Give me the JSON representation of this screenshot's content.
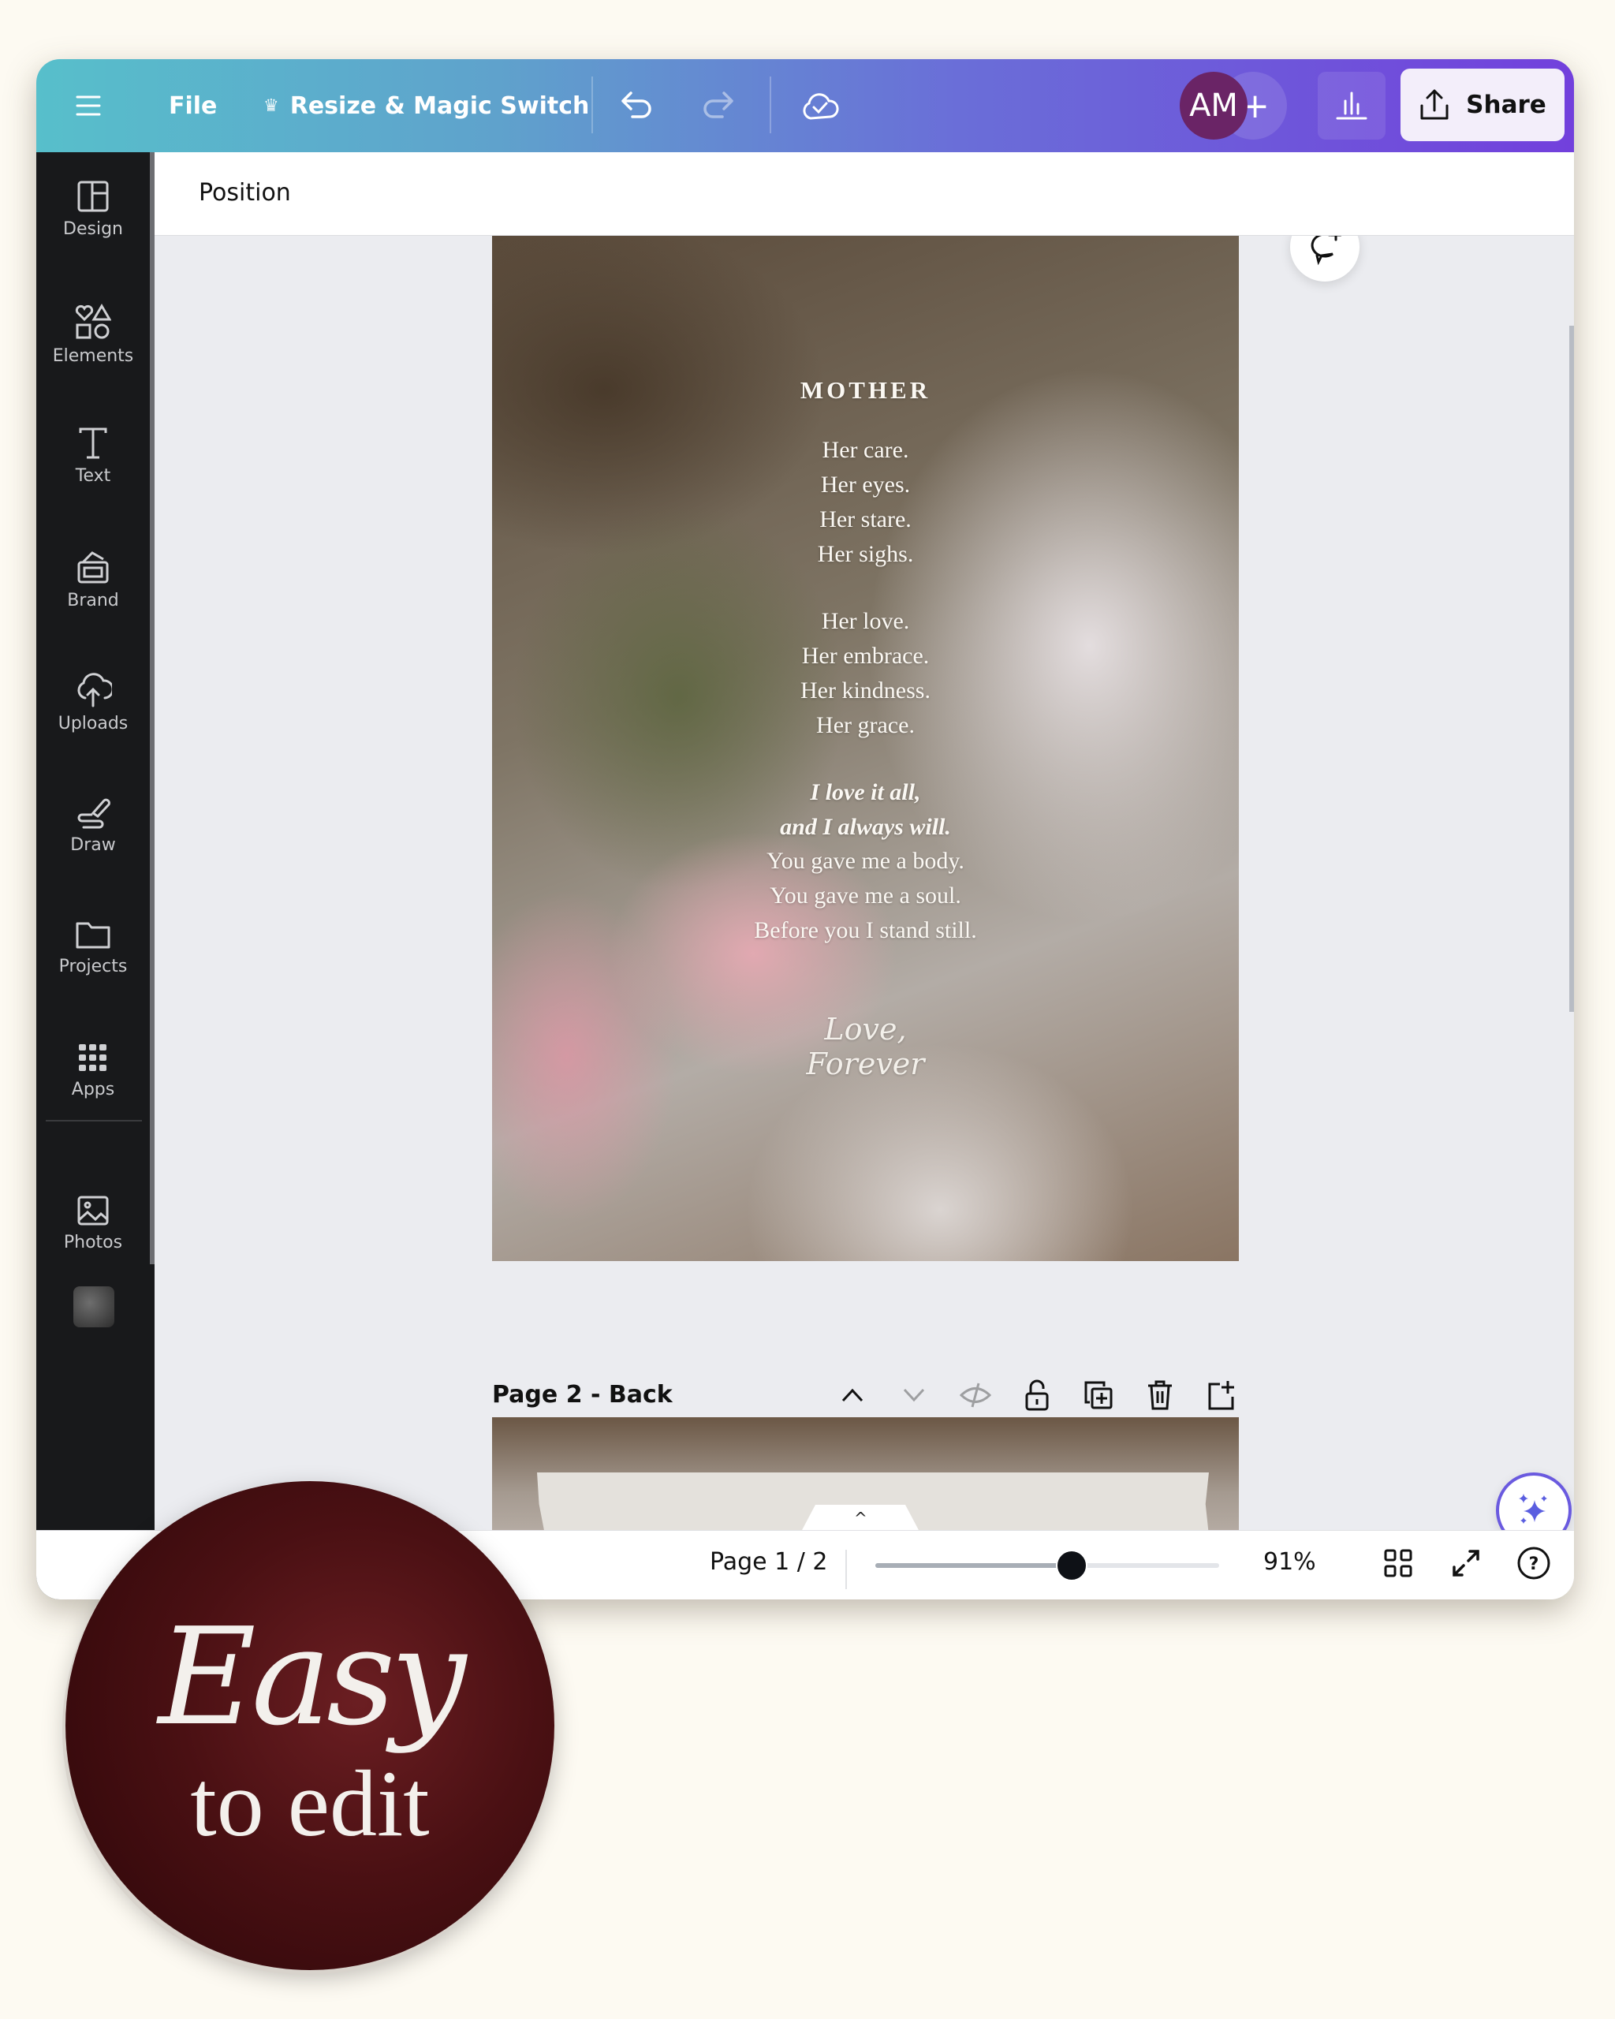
{
  "topbar": {
    "menu_icon": "hamburger-menu-icon",
    "file_label": "File",
    "resize_label": "Resize & Magic Switch",
    "resize_icon": "crown-icon",
    "undo_icon": "undo-icon",
    "redo_icon": "redo-icon",
    "cloud_icon": "cloud-saved-icon",
    "avatar_initials": "AM",
    "add_collaborator_label": "+",
    "analytics_icon": "bar-chart-icon",
    "share_label": "Share",
    "share_icon": "upload-share-icon"
  },
  "sidebar": {
    "items": [
      {
        "label": "Design",
        "icon": "layout-icon"
      },
      {
        "label": "Elements",
        "icon": "shapes-icon"
      },
      {
        "label": "Text",
        "icon": "text-t-icon"
      },
      {
        "label": "Brand",
        "icon": "brand-kit-icon"
      },
      {
        "label": "Uploads",
        "icon": "cloud-upload-icon"
      },
      {
        "label": "Draw",
        "icon": "pen-draw-icon"
      },
      {
        "label": "Projects",
        "icon": "folder-icon"
      },
      {
        "label": "Apps",
        "icon": "apps-grid-icon"
      },
      {
        "label": "Photos",
        "icon": "image-icon"
      }
    ],
    "recent_design_thumbnail": "recent-design-thumbnail"
  },
  "context_bar": {
    "label": "Position"
  },
  "page1": {
    "title": "MOTHER",
    "stanza1": [
      "Her care.",
      "Her eyes.",
      "Her stare.",
      "Her sighs."
    ],
    "stanza2": [
      "Her love.",
      "Her embrace.",
      "Her kindness.",
      "Her grace."
    ],
    "stanza3": [
      "I love it all,",
      "and I always will."
    ],
    "stanza4": [
      "You gave me a body.",
      "You gave me a soul.",
      "Before you I stand still."
    ],
    "signature": [
      "Love,",
      "Forever"
    ]
  },
  "page2": {
    "title": "Page 2 - Back",
    "actions": [
      "move-up",
      "move-down",
      "hide",
      "lock",
      "duplicate",
      "delete",
      "add-page"
    ]
  },
  "bottombar": {
    "page_indicator": "Page 1 / 2",
    "zoom_percent": "91%",
    "zoom_slider_fraction": 0.57,
    "grid_view_icon": "grid-view-icon",
    "fullscreen_icon": "fullscreen-icon",
    "help_icon": "help-icon"
  },
  "badge": {
    "line1": "Easy",
    "line2": "to edit"
  }
}
